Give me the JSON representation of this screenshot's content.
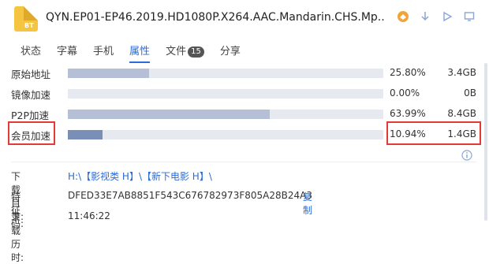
{
  "header": {
    "file_ext": "BT",
    "title": "QYN.EP01-EP46.2019.HD1080P.X264.AAC.Mandarin.CHS.Mp..."
  },
  "tabs": [
    {
      "label": "状态"
    },
    {
      "label": "字幕"
    },
    {
      "label": "手机"
    },
    {
      "label": "属性"
    },
    {
      "label": "文件",
      "badge": "15"
    },
    {
      "label": "分享"
    }
  ],
  "rows": [
    {
      "label": "原始地址",
      "percent": "25.80%",
      "size": "3.4GB",
      "fill": 0.258
    },
    {
      "label": "镜像加速",
      "percent": "0.00%",
      "size": "0B",
      "fill": 0.0
    },
    {
      "label": "P2P加速",
      "percent": "63.99%",
      "size": "8.4GB",
      "fill": 0.6399
    },
    {
      "label": "会员加速",
      "percent": "10.94%",
      "size": "1.4GB",
      "fill": 0.1094
    }
  ],
  "details": {
    "download_dir_label": "下载目录:",
    "download_dir_value": "H:\\【影视类 H】\\【新下电影 H】\\",
    "hash_label": "特征码:",
    "hash_value": "DFED33E7AB8851F543C676782973F805A28B24A3",
    "copy_label": "复制",
    "elapsed_label": "下载历时:",
    "elapsed_value": "11:46:22"
  },
  "colors": {
    "accent": "#2b6cd6",
    "highlight": "#e53935",
    "bar_track": "#e6e9ef",
    "bar_fill": "#b5c0d6",
    "bar_fill_vip": "#7a8fb8"
  }
}
